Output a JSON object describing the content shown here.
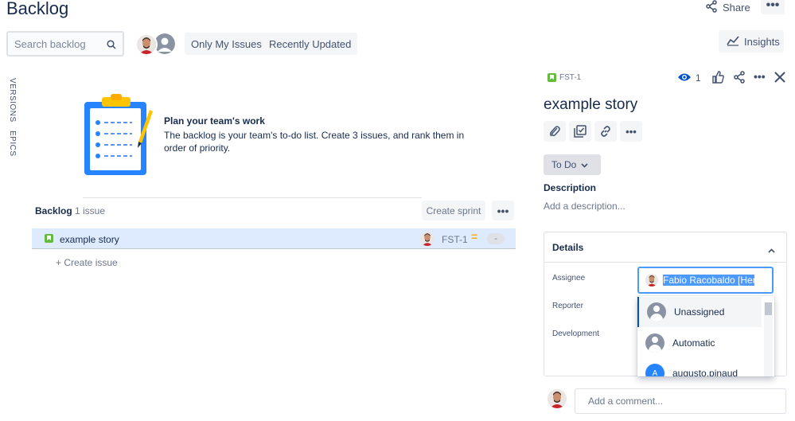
{
  "header": {
    "title": "Backlog",
    "share_label": "Share",
    "more_label": "•••"
  },
  "toolbar": {
    "search_placeholder": "Search backlog",
    "filters": [
      "Only My Issues",
      "Recently Updated"
    ],
    "insights_label": "Insights"
  },
  "side_tabs": [
    "VERSIONS",
    "EPICS"
  ],
  "empty_state": {
    "title": "Plan your team's work",
    "description": "The backlog is your team's to-do list. Create 3 issues, and rank them in order of priority."
  },
  "backlog": {
    "title": "Backlog",
    "count": "1 issue",
    "create_sprint": "Create sprint",
    "more": "•••",
    "issues": [
      {
        "summary": "example story",
        "key": "FST-1",
        "estimate": "-"
      }
    ],
    "create_issue": "+ Create issue"
  },
  "detail": {
    "key": "FST-1",
    "watch_count": "1",
    "title": "example story",
    "status": "To Do",
    "description_label": "Description",
    "description_placeholder": "Add a description...",
    "details_title": "Details",
    "fields": {
      "assignee_label": "Assignee",
      "reporter_label": "Reporter",
      "development_label": "Development",
      "assignee_value": "Fabio Racobaldo [Herz"
    },
    "assignee_options": [
      {
        "label": "Unassigned",
        "avatar": "person-icon"
      },
      {
        "label": "Automatic",
        "avatar": "person-icon"
      },
      {
        "label": "augusto.pinaud",
        "avatar": "A"
      }
    ],
    "comment_placeholder": "Add a comment..."
  },
  "colors": {
    "accent": "#0052cc",
    "story_green": "#63ba3c",
    "priority_medium": "#ffab00",
    "selected_row": "#deebff",
    "focus_blue": "#4c9aff"
  }
}
